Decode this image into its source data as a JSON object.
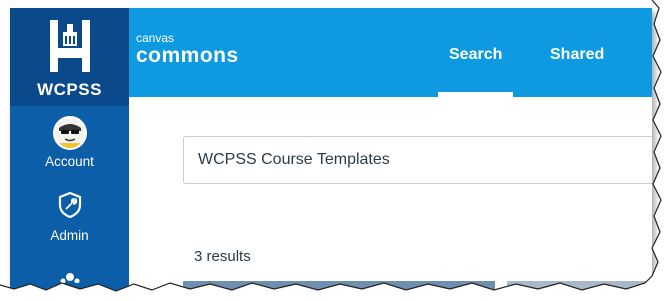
{
  "sidebar": {
    "logo_text": "WCPSS",
    "items": [
      {
        "label": "Account",
        "icon": "avatar-icon"
      },
      {
        "label": "Admin",
        "icon": "shield-wrench-icon"
      }
    ]
  },
  "topbar": {
    "brand_small": "canvas",
    "brand_big": "commons",
    "tabs": [
      {
        "label": "Search",
        "active": true
      },
      {
        "label": "Shared",
        "active": false
      }
    ]
  },
  "search": {
    "value": "WCPSS Course Templates"
  },
  "results_text": "3 results",
  "colors": {
    "sidebar": "#0c5ea8",
    "topbar": "#0d9ae0",
    "text": "#2d3b45"
  }
}
